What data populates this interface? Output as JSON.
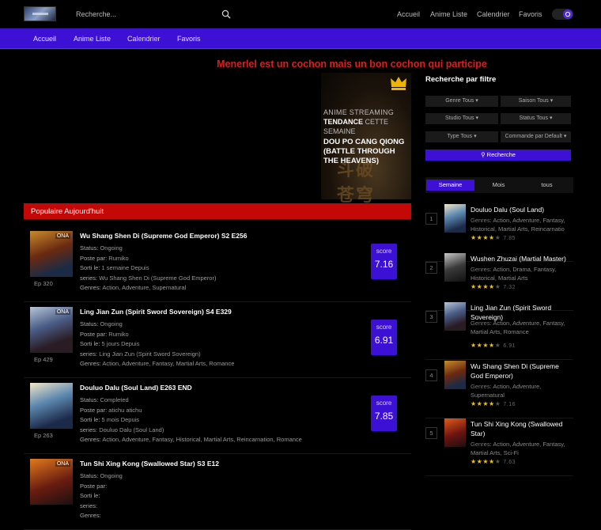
{
  "header": {
    "search_placeholder": "Recherche...",
    "nav": [
      "Accueil",
      "Anime Liste",
      "Calendrier",
      "Favoris"
    ]
  },
  "menu": [
    "Accueil",
    "Anime Liste",
    "Calendrier",
    "Favoris"
  ],
  "banner": "Menerlel est un cochon mais un bon cochon qui participe",
  "hero": {
    "line1": "ANIME STREAMING",
    "line2_bold": "TENDANCE",
    "line2_rest": " CETTE",
    "line3": "SEMAINE",
    "title": "DOU PO CANG QIONG (BATTLE THROUGH THE HEAVENS)"
  },
  "popular": {
    "heading": "Populaire Aujourd'huit",
    "labels": {
      "status": "Status:",
      "poster": "Poste par:",
      "released": "Sorti le:",
      "series": "series:",
      "genres": "Genres:",
      "score": "score"
    },
    "items": [
      {
        "title": "Wu Shang Shen Di (Supreme God Emperor) S2 E256",
        "badge": "ONA",
        "ep": "Ep 320",
        "status": "Ongoing",
        "poster": "Rumiko",
        "released": "1 semaine Depuis",
        "series": "Wu Shang Shen Di (Supreme God Emperor)",
        "genres": "Action, Adventure, Supernatural",
        "score": "7.16"
      },
      {
        "title": "Ling Jian Zun (Spirit Sword Sovereign) S4 E329",
        "badge": "ONA",
        "ep": "Ep 429",
        "status": "Ongoing",
        "poster": "Rumiko",
        "released": "5 jours Depuis",
        "series": "Ling Jian Zun (Spirit Sword Sovereign)",
        "genres": "Action, Adventure, Fantasy, Martial Arts, Romance",
        "score": "6.91"
      },
      {
        "title": "Douluo Dalu (Soul Land) E263 END",
        "badge": "",
        "ep": "Ep 263",
        "status": "Completed",
        "poster": "atichu atichu",
        "released": "5 mois Depuis",
        "series": "Douluo Dalu (Soul Land)",
        "genres": "Action, Adventure, Fantasy, Historical, Martial Arts, Reincarnation, Romance",
        "score": "7.85"
      },
      {
        "title": "Tun Shi Xing Kong (Swallowed Star) S3 E12",
        "badge": "ONA",
        "ep": "",
        "status": "Ongoing",
        "poster": "",
        "released": "",
        "series": "",
        "genres": "",
        "score": ""
      }
    ]
  },
  "sidebar": {
    "title": "Recherche par filtre",
    "filters": [
      "Genre Tous",
      "Saison Tous",
      "Studio Tous",
      "Status Tous",
      "Type Tous",
      "Commande par Default"
    ],
    "search_button": "Recherche",
    "tabs": [
      "Semaine",
      "Mois",
      "tous"
    ],
    "genres_label": "Genres:",
    "items": [
      {
        "rank": "1",
        "title": "Douluo Dalu (Soul Land)",
        "genres": "Action, Adventure, Fantasy, Historical, Martial Arts, Reincarnatio",
        "rating": "7.85",
        "stars": 4.0
      },
      {
        "rank": "2",
        "title": "Wushen Zhuzai (Martial Master)",
        "genres": "Action, Drama, Fantasy, Historical, Martial Arts",
        "rating": "7.32",
        "stars": 3.5
      },
      {
        "rank": "3",
        "title": "Ling Jian Zun (Spirit Sword Sovereign)",
        "genres": "Action, Adventure, Fantasy, Martial Arts, Romance",
        "rating": "6.91",
        "stars": 3.5
      },
      {
        "rank": "4",
        "title": "Wu Shang Shen Di (Supreme God Emperor)",
        "genres": "Action, Adventure, Supernatural",
        "rating": "7.16",
        "stars": 3.5
      },
      {
        "rank": "5",
        "title": "Tun Shi Xing Kong (Swallowed Star)",
        "genres": "Action, Adventure, Fantasy, Martial Arts, Sci-Fi",
        "rating": "7.63",
        "stars": 4.0
      }
    ]
  },
  "colors": {
    "accent": "#3d10d6",
    "section_red": "#c40808",
    "banner_red": "#e21b1b",
    "star": "#f3c200"
  }
}
